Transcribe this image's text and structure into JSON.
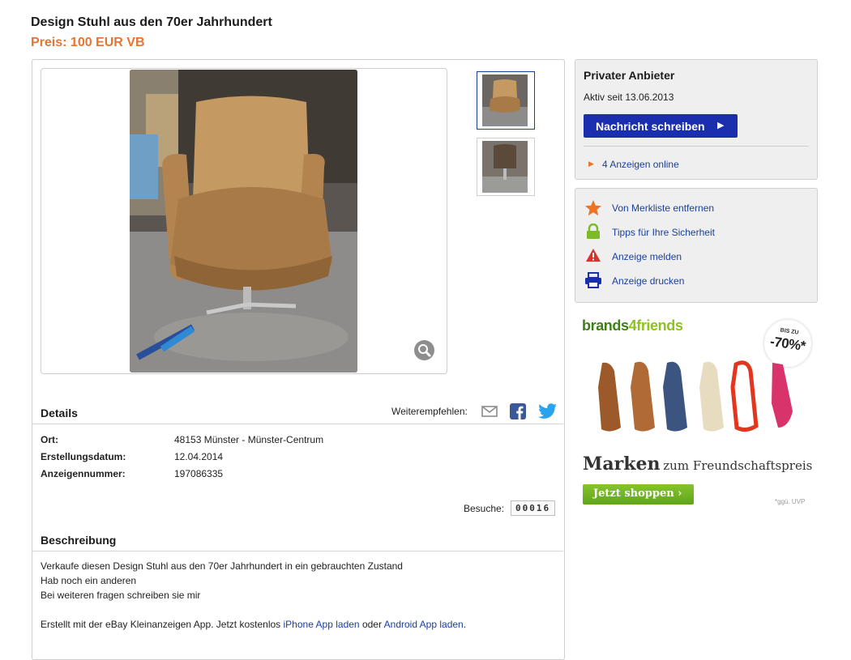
{
  "listing": {
    "title": "Design Stuhl aus den 70er Jahrhundert",
    "price": "Preis: 100 EUR VB"
  },
  "details": {
    "heading": "Details",
    "share_label": "Weiterempfehlen:",
    "rows": [
      {
        "label": "Ort:",
        "value": "48153 Münster - Münster-Centrum"
      },
      {
        "label": "Erstellungsdatum:",
        "value": "12.04.2014"
      },
      {
        "label": "Anzeigennummer:",
        "value": "197086335"
      }
    ],
    "visits_label": "Besuche:",
    "visits_count": "00016"
  },
  "description": {
    "heading": "Beschreibung",
    "lines": [
      "Verkaufe diesen Design Stuhl aus den 70er Jahrhundert in ein gebrauchten Zustand",
      "Hab noch ein anderen",
      "Bei weiteren fragen schreiben sie mir"
    ],
    "footer_prefix": "Erstellt mit der eBay Kleinanzeigen App. Jetzt kostenlos",
    "iphone_link": "iPhone App laden",
    "footer_mid": "oder",
    "android_link": "Android App laden",
    "footer_suffix": "."
  },
  "seller": {
    "type": "Privater Anbieter",
    "active_since": "Aktiv seit 13.06.2013",
    "message_button": "Nachricht schreiben",
    "ads_online": "4 Anzeigen online"
  },
  "actions": [
    {
      "label": "Von Merkliste entfernen",
      "icon": "star-icon"
    },
    {
      "label": "Tipps für Ihre Sicherheit",
      "icon": "lock-icon"
    },
    {
      "label": "Anzeige melden",
      "icon": "warning-icon"
    },
    {
      "label": "Anzeige drucken",
      "icon": "printer-icon"
    }
  ],
  "ad": {
    "logo_prefix": "brands",
    "logo_suffix": "4friends",
    "badge_top": "BIS ZU",
    "badge_value": "-70%*",
    "headline_big": "Marken",
    "headline_small": "zum Freundschaftspreis",
    "button": "Jetzt shoppen ›",
    "footnote": "*ggü. UVP"
  },
  "colors": {
    "price": "#e8742e",
    "link": "#1a3f9c",
    "primary_button": "#1b2fae",
    "ad_green": "#6fb51f"
  }
}
